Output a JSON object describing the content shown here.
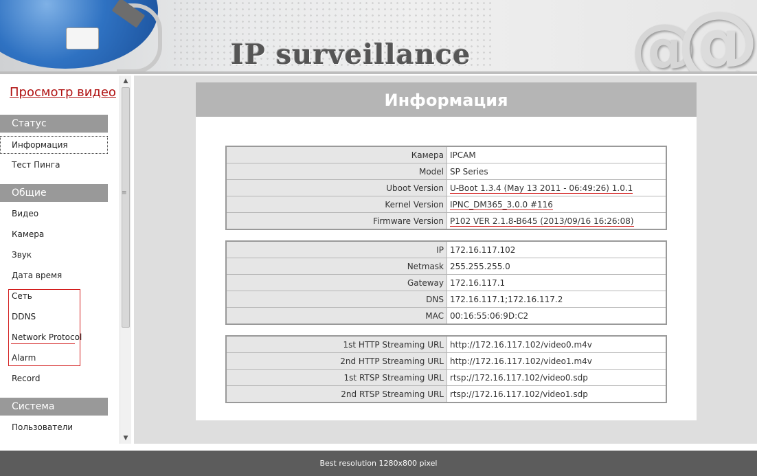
{
  "header": {
    "title": "IP surveillance"
  },
  "sidebar": {
    "live_view": "Просмотр видео",
    "sections": [
      {
        "label": "Статус",
        "items": [
          {
            "label": "Информация"
          },
          {
            "label": "Тест Пинга"
          }
        ]
      },
      {
        "label": "Общие",
        "items": [
          {
            "label": "Видео"
          },
          {
            "label": "Камера"
          },
          {
            "label": "Звук"
          },
          {
            "label": "Дата время"
          },
          {
            "label": "Сеть"
          },
          {
            "label": "DDNS"
          },
          {
            "label": "Network Protocol"
          },
          {
            "label": "Alarm"
          },
          {
            "label": "Record"
          }
        ]
      },
      {
        "label": "Система",
        "items": [
          {
            "label": "Пользователи"
          }
        ]
      }
    ]
  },
  "main": {
    "title": "Информация",
    "device": [
      {
        "k": "Камера",
        "v": "IPCAM"
      },
      {
        "k": "Model",
        "v": "SP Series"
      },
      {
        "k": "Uboot Version",
        "v": "U-Boot 1.3.4 (May 13 2011 - 06:49:26) 1.0.1"
      },
      {
        "k": "Kernel Version",
        "v": "IPNC_DM365_3.0.0 #116"
      },
      {
        "k": "Firmware Version",
        "v": "P102 VER 2.1.8-B645 (2013/09/16 16:26:08)"
      }
    ],
    "network": [
      {
        "k": "IP",
        "v": "172.16.117.102"
      },
      {
        "k": "Netmask",
        "v": "255.255.255.0"
      },
      {
        "k": "Gateway",
        "v": "172.16.117.1"
      },
      {
        "k": "DNS",
        "v": "172.16.117.1;172.16.117.2"
      },
      {
        "k": "MAC",
        "v": "00:16:55:06:9D:C2"
      }
    ],
    "streams": [
      {
        "k": "1st HTTP Streaming URL",
        "v": "http://172.16.117.102/video0.m4v"
      },
      {
        "k": "2nd HTTP Streaming URL",
        "v": "http://172.16.117.102/video1.m4v"
      },
      {
        "k": "1st RTSP Streaming URL",
        "v": "rtsp://172.16.117.102/video0.sdp"
      },
      {
        "k": "2nd RTSP Streaming URL",
        "v": "rtsp://172.16.117.102/video1.sdp"
      }
    ]
  },
  "footer": {
    "text": "Best resolution 1280x800 pixel"
  }
}
